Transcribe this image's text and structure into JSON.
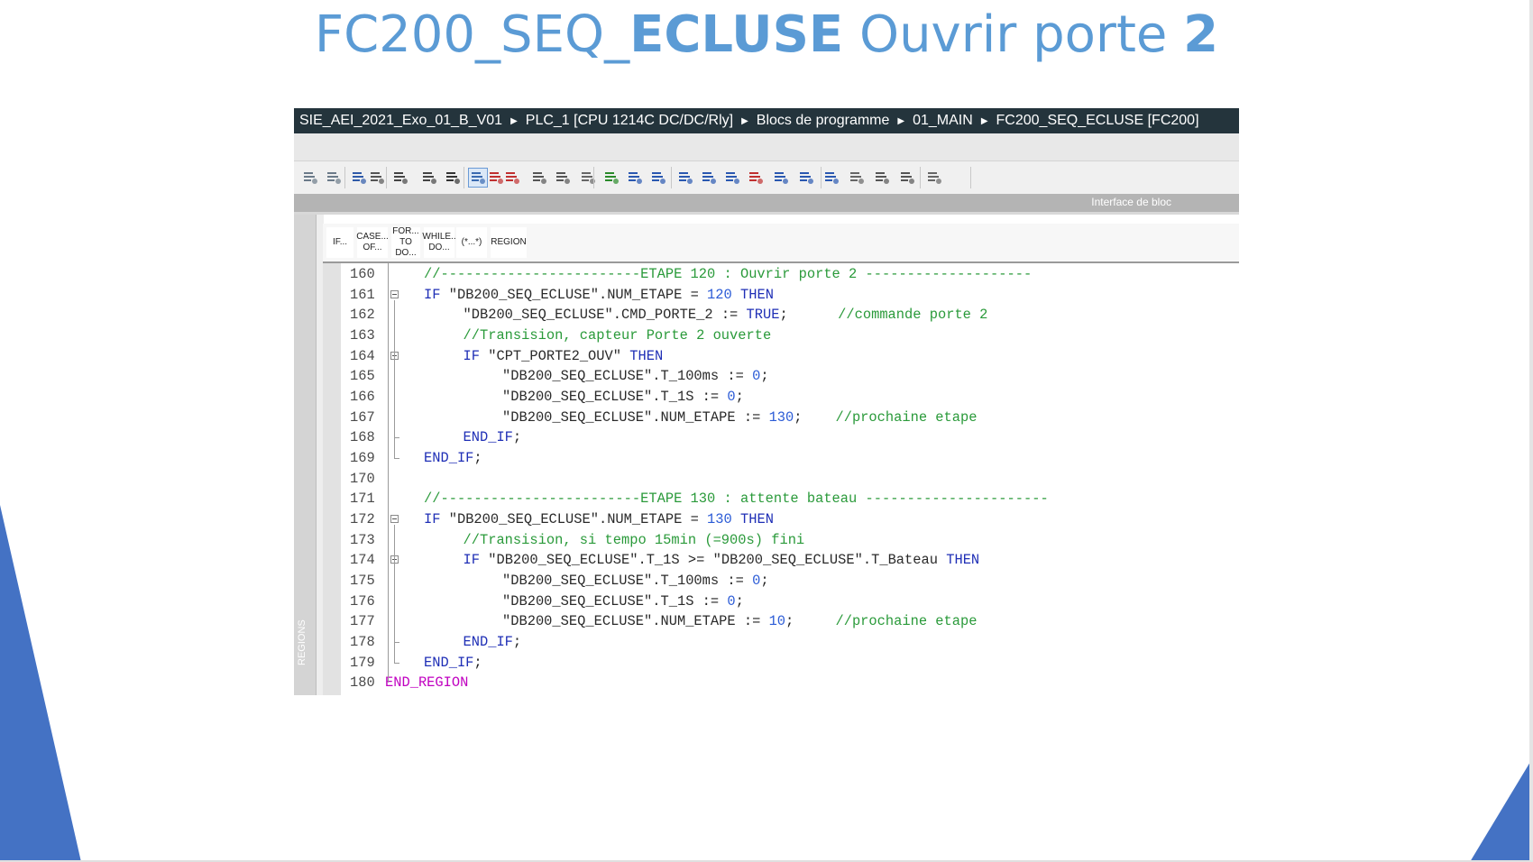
{
  "slide": {
    "title_part1": "FC200_SEQ_",
    "title_bold1": "ECLUSE",
    "title_part2": " Ouvrir porte ",
    "title_bold2": "2",
    "accent_color": "#5b9bd5",
    "shape_color": "#4472c4"
  },
  "ide": {
    "breadcrumb": [
      "SIE_AEI_2021_Exo_01_B_V01",
      "PLC_1 [CPU 1214C DC/DC/Rly]",
      "Blocs de programme",
      "01_MAIN",
      "FC200_SEQ_ECLUSE [FC200]"
    ],
    "interface_label": "Interface de bloc",
    "regions_label": "REGIONS",
    "keyword_buttons": [
      {
        "l1": "IF...",
        "l2": ""
      },
      {
        "l1": "CASE...",
        "l2": "OF..."
      },
      {
        "l1": "FOR...",
        "l2": "TO DO..."
      },
      {
        "l1": "WHILE..",
        "l2": "DO..."
      },
      {
        "l1": "(*...*)",
        "l2": ""
      },
      {
        "l1": "REGION",
        "l2": ""
      }
    ],
    "toolbar_icons": [
      "indent-icon",
      "outdent-icon",
      "insert-icon",
      "bookmark-icon",
      "list-icon",
      "block-icon",
      "download-icon",
      "select-icon",
      "breakpoint-remove-icon",
      "breakpoint-delete-icon",
      "breakpoint-icon",
      "watch-icon",
      "list-view-icon",
      "check-icon",
      "go-left-icon",
      "indent-increase-icon",
      "indent-decrease-icon",
      "grid-icon",
      "sort-icon",
      "sort-red-icon",
      "star-icon",
      "refresh-left-icon",
      "refresh-right-icon",
      "settings-icon",
      "monitor-icon",
      "monitor-off-icon",
      "database-icon"
    ],
    "code_lines": [
      {
        "n": "160",
        "i": 1,
        "fold": false,
        "tokens": [
          {
            "t": "cm",
            "v": "//------------------------ETAPE 120 : Ouvrir porte 2 --------------------"
          }
        ]
      },
      {
        "n": "161",
        "i": 1,
        "fold": true,
        "tokens": [
          {
            "t": "kw",
            "v": "IF "
          },
          {
            "t": "str",
            "v": "\"DB200_SEQ_ECLUSE\".NUM_ETAPE"
          },
          {
            "t": "pl",
            "v": " = "
          },
          {
            "t": "num",
            "v": "120"
          },
          {
            "t": "kw",
            "v": " THEN"
          }
        ]
      },
      {
        "n": "162",
        "i": 2,
        "fold": false,
        "tokens": [
          {
            "t": "str",
            "v": "\"DB200_SEQ_ECLUSE\".CMD_PORTE_2"
          },
          {
            "t": "pl",
            "v": " := "
          },
          {
            "t": "kw",
            "v": "TRUE"
          },
          {
            "t": "pl",
            "v": ";      "
          },
          {
            "t": "cm",
            "v": "//commande porte 2"
          }
        ]
      },
      {
        "n": "163",
        "i": 2,
        "fold": false,
        "tokens": [
          {
            "t": "cm",
            "v": "//Transision, capteur Porte 2 ouverte"
          }
        ]
      },
      {
        "n": "164",
        "i": 2,
        "fold": true,
        "tokens": [
          {
            "t": "kw",
            "v": "IF "
          },
          {
            "t": "str",
            "v": "\"CPT_PORTE2_OUV\""
          },
          {
            "t": "kw",
            "v": " THEN"
          }
        ]
      },
      {
        "n": "165",
        "i": 3,
        "fold": false,
        "tokens": [
          {
            "t": "str",
            "v": "\"DB200_SEQ_ECLUSE\".T_100ms"
          },
          {
            "t": "pl",
            "v": " := "
          },
          {
            "t": "num",
            "v": "0"
          },
          {
            "t": "pl",
            "v": ";"
          }
        ]
      },
      {
        "n": "166",
        "i": 3,
        "fold": false,
        "tokens": [
          {
            "t": "str",
            "v": "\"DB200_SEQ_ECLUSE\".T_1S"
          },
          {
            "t": "pl",
            "v": " := "
          },
          {
            "t": "num",
            "v": "0"
          },
          {
            "t": "pl",
            "v": ";"
          }
        ]
      },
      {
        "n": "167",
        "i": 3,
        "fold": false,
        "tokens": [
          {
            "t": "str",
            "v": "\"DB200_SEQ_ECLUSE\".NUM_ETAPE"
          },
          {
            "t": "pl",
            "v": " := "
          },
          {
            "t": "num",
            "v": "130"
          },
          {
            "t": "pl",
            "v": ";    "
          },
          {
            "t": "cm",
            "v": "//prochaine etape"
          }
        ]
      },
      {
        "n": "168",
        "i": 2,
        "fold": false,
        "tokens": [
          {
            "t": "kw",
            "v": "END_IF"
          },
          {
            "t": "pl",
            "v": ";"
          }
        ]
      },
      {
        "n": "169",
        "i": 1,
        "fold": false,
        "tokens": [
          {
            "t": "kw",
            "v": "END_IF"
          },
          {
            "t": "pl",
            "v": ";"
          }
        ]
      },
      {
        "n": "170",
        "i": 0,
        "fold": false,
        "tokens": []
      },
      {
        "n": "171",
        "i": 1,
        "fold": false,
        "tokens": [
          {
            "t": "cm",
            "v": "//------------------------ETAPE 130 : attente bateau ----------------------"
          }
        ]
      },
      {
        "n": "172",
        "i": 1,
        "fold": true,
        "tokens": [
          {
            "t": "kw",
            "v": "IF "
          },
          {
            "t": "str",
            "v": "\"DB200_SEQ_ECLUSE\".NUM_ETAPE"
          },
          {
            "t": "pl",
            "v": " = "
          },
          {
            "t": "num",
            "v": "130"
          },
          {
            "t": "kw",
            "v": " THEN"
          }
        ]
      },
      {
        "n": "173",
        "i": 2,
        "fold": false,
        "tokens": [
          {
            "t": "cm",
            "v": "//Transision, si tempo 15min (=900s) fini"
          }
        ]
      },
      {
        "n": "174",
        "i": 2,
        "fold": true,
        "tokens": [
          {
            "t": "kw",
            "v": "IF "
          },
          {
            "t": "str",
            "v": "\"DB200_SEQ_ECLUSE\".T_1S"
          },
          {
            "t": "pl",
            "v": " >= "
          },
          {
            "t": "str",
            "v": "\"DB200_SEQ_ECLUSE\".T_Bateau"
          },
          {
            "t": "kw",
            "v": " THEN"
          }
        ]
      },
      {
        "n": "175",
        "i": 3,
        "fold": false,
        "tokens": [
          {
            "t": "str",
            "v": "\"DB200_SEQ_ECLUSE\".T_100ms"
          },
          {
            "t": "pl",
            "v": " := "
          },
          {
            "t": "num",
            "v": "0"
          },
          {
            "t": "pl",
            "v": ";"
          }
        ]
      },
      {
        "n": "176",
        "i": 3,
        "fold": false,
        "tokens": [
          {
            "t": "str",
            "v": "\"DB200_SEQ_ECLUSE\".T_1S"
          },
          {
            "t": "pl",
            "v": " := "
          },
          {
            "t": "num",
            "v": "0"
          },
          {
            "t": "pl",
            "v": ";"
          }
        ]
      },
      {
        "n": "177",
        "i": 3,
        "fold": false,
        "tokens": [
          {
            "t": "str",
            "v": "\"DB200_SEQ_ECLUSE\".NUM_ETAPE"
          },
          {
            "t": "pl",
            "v": " := "
          },
          {
            "t": "num",
            "v": "10"
          },
          {
            "t": "pl",
            "v": ";     "
          },
          {
            "t": "cm",
            "v": "//prochaine etape"
          }
        ]
      },
      {
        "n": "178",
        "i": 2,
        "fold": false,
        "tokens": [
          {
            "t": "kw",
            "v": "END_IF"
          },
          {
            "t": "pl",
            "v": ";"
          }
        ]
      },
      {
        "n": "179",
        "i": 1,
        "fold": false,
        "tokens": [
          {
            "t": "kw",
            "v": "END_IF"
          },
          {
            "t": "pl",
            "v": ";"
          }
        ]
      },
      {
        "n": "180",
        "i": 0,
        "fold": false,
        "tokens": [
          {
            "t": "mg",
            "v": "END_REGION"
          }
        ]
      }
    ]
  }
}
